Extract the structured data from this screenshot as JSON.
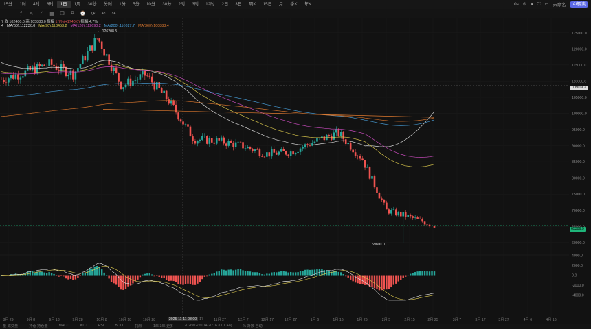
{
  "toolbar": {
    "timeframes": [
      "15分",
      "1时",
      "4时",
      "8时",
      "1日",
      "1周",
      "30秒",
      "分时",
      "1分",
      "5分",
      "10分",
      "30分",
      "2时",
      "3时",
      "12时",
      "2日",
      "3日",
      "周K",
      "15日",
      "月",
      "季K",
      "年K"
    ],
    "active_index": 4,
    "right_items": [
      "0s",
      "设置",
      "截图",
      "全屏",
      "关闭"
    ],
    "indicator_label": "未命名",
    "pill_label": "AI解读"
  },
  "legend": {
    "line1_prefix": "7  收 102400.0  高 105880.0  振幅",
    "line1_change": "1.7%(+1740.0)",
    "line1_amp": "振幅 4.7%",
    "ma": [
      {
        "label": "MA(60):112230.0",
        "color": "#e8e8e8"
      },
      {
        "label": "MA(90):113453.2",
        "color": "#e5d150"
      },
      {
        "label": "MA(120):112690.2",
        "color": "#d34fc6"
      },
      {
        "label": "MA(200):110027.7",
        "color": "#4aa3df"
      },
      {
        "label": "MA(360):100883.4",
        "color": "#e07a2f"
      }
    ]
  },
  "price_axis": {
    "ticks": [
      "125000.0",
      "120000.0",
      "115000.0",
      "110000.0",
      "105000.0",
      "100000.0",
      "95000.0",
      "90000.0",
      "85000.0",
      "80000.0",
      "75000.0",
      "70000.0",
      "65000.0",
      "60000.0"
    ],
    "crosshair_label": "108619.2",
    "last_label": "65306.9"
  },
  "macd_axis": {
    "ticks": [
      "4000.0",
      "2000.0",
      "0.0",
      "-2000.0",
      "-4000.0"
    ]
  },
  "annotations": {
    "high": "← 126208.5",
    "low": "59800.0 →"
  },
  "date_axis": {
    "labels": [
      "8月 29",
      "9月 8",
      "9月 18",
      "9月 28",
      "10月 8",
      "10月 18",
      "10月 28",
      "11月 27",
      "12月 7",
      "12月 17",
      "12月 27",
      "1月 6",
      "1月 16",
      "1月 26",
      "2月 5",
      "2月 15",
      "2月 25",
      "3月 7",
      "3月 17",
      "3月 27",
      "4月 6",
      "4月 16"
    ],
    "crosshair_date": "2025-11-11 08:00",
    "crosshair_tail": "17"
  },
  "bottom_bar": [
    "量 成交量",
    "持仓 持仓量",
    "MACD",
    "KDJ",
    "RSI",
    "BOLL",
    "指标",
    "1年  3年  更多",
    "2026/02/20 14:20:16 (UTC+8)",
    "% 对数 自动"
  ],
  "chart_data": {
    "type": "candlestick",
    "title": "",
    "y_range": [
      57000,
      127500
    ],
    "interval": "1日",
    "candles_per_day": 1,
    "x": [
      "8月 29",
      "9月 8",
      "9月 18",
      "9月 28",
      "10月 8",
      "10月 18",
      "10月 28",
      "11月 7",
      "11月 17",
      "11月 27",
      "12月 7",
      "12月 17",
      "12月 27",
      "1月 6",
      "1月 16",
      "1月 26",
      "2月 5",
      "2月 15",
      "2月 25"
    ],
    "close": [
      110500,
      112800,
      115300,
      112200,
      123500,
      108500,
      112000,
      103500,
      92000,
      91500,
      90000,
      87500,
      88000,
      91200,
      94000,
      86000,
      70000,
      67800,
      65306.9
    ],
    "high_mark": 126208.5,
    "low_mark": 59800.0,
    "ma_series": [
      {
        "name": "MA(60)",
        "end": 101500
      },
      {
        "name": "MA(90)",
        "end": 84500
      },
      {
        "name": "MA(120)",
        "end": 87000
      },
      {
        "name": "MA(200)",
        "end": 98300
      },
      {
        "name": "MA(360)",
        "end": 98800
      }
    ],
    "macd": {
      "range": [
        -5000,
        3500
      ],
      "last_hist": 900
    }
  },
  "colors": {
    "up": "#26a69a",
    "down": "#ef5350",
    "background": "#121212",
    "grid": "#1c1c1c"
  }
}
